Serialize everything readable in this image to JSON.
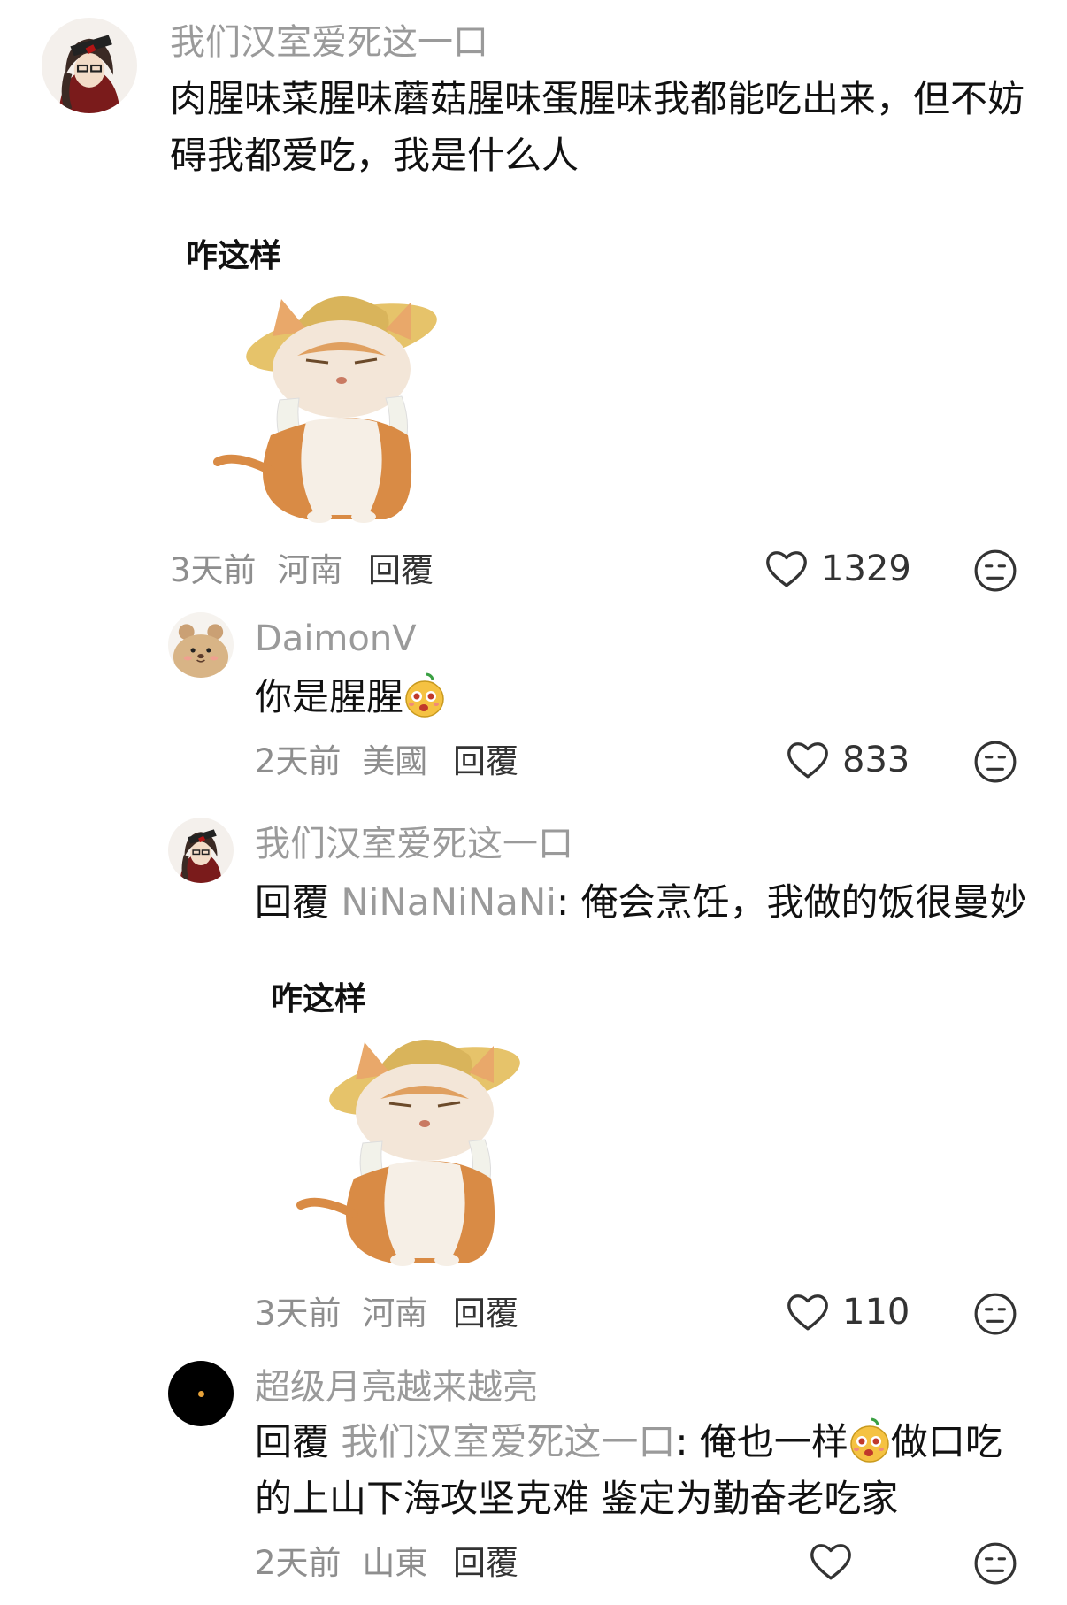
{
  "comments": [
    {
      "username": "我们汉室爱死这一口",
      "text": "肉腥味菜腥味蘑菇腥味蛋腥味我都能吃出来，但不妨碍我都爱吃，我是什么人",
      "sticker_caption": "咋这样",
      "time": "3天前",
      "location": "河南",
      "reply_label": "回覆",
      "likes": "1329"
    },
    {
      "username": "DaimonV",
      "text": "你是腥腥",
      "time": "2天前",
      "location": "美國",
      "reply_label": "回覆",
      "likes": "833"
    },
    {
      "username": "我们汉室爱死这一口",
      "reply_prefix": "回覆",
      "reply_to": "NiNaNiNaNi",
      "text": ": 俺会烹饪，我做的饭很曼妙",
      "sticker_caption": "咋这样",
      "time": "3天前",
      "location": "河南",
      "reply_label": "回覆",
      "likes": "110"
    },
    {
      "username": "超级月亮越来越亮",
      "reply_prefix": "回覆",
      "reply_to": "我们汉室爱死这一口",
      "text_part1": ": 俺也一样",
      "text_part2": "做口吃的上山下海攻坚克难 鉴定为勤奋老吃家",
      "time": "2天前",
      "location": "山東",
      "reply_label": "回覆"
    }
  ],
  "icons": [
    "heart-icon",
    "neutral-face-icon",
    "pear-face-emoji"
  ],
  "colors": {
    "username": "#9a9a9a",
    "text": "#111111",
    "meta": "#8e8e8e"
  }
}
